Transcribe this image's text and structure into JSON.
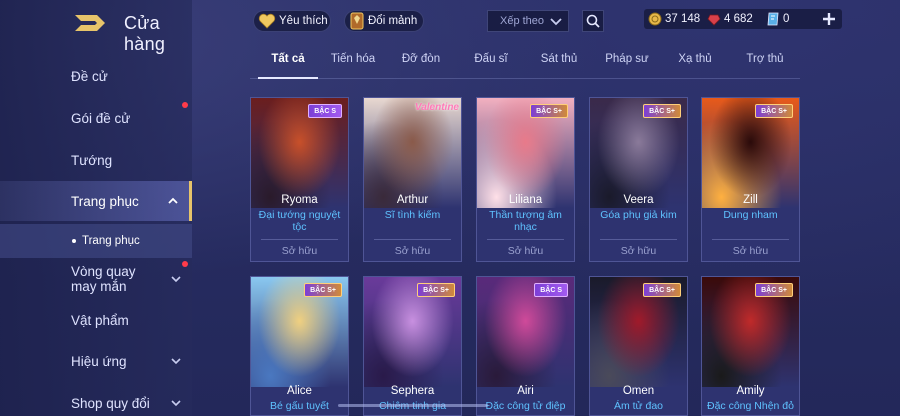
{
  "header": {
    "title": "Cửa hàng"
  },
  "sidebar": {
    "items": [
      {
        "label": "Đề cử"
      },
      {
        "label": "Gói đề cử"
      },
      {
        "label": "Tướng"
      },
      {
        "label": "Trang phục"
      },
      {
        "label": "Vòng quay may mắn"
      },
      {
        "label": "Vật phẩm"
      },
      {
        "label": "Hiệu ứng"
      },
      {
        "label": "Shop quy đổi"
      }
    ],
    "sub": {
      "label": "Trang phục"
    }
  },
  "topbar": {
    "favorite_label": "Yêu thích",
    "exchange_label": "Đổi mảnh",
    "sort_placeholder": "Xếp theo"
  },
  "currency": {
    "gold": "37 148",
    "gems": "4 682",
    "vouchers": "0"
  },
  "tabs": [
    {
      "label": "Tất cả"
    },
    {
      "label": "Tiến hóa"
    },
    {
      "label": "Đỡ đòn"
    },
    {
      "label": "Đấu sĩ"
    },
    {
      "label": "Sát thủ"
    },
    {
      "label": "Pháp sư"
    },
    {
      "label": "Xạ thủ"
    },
    {
      "label": "Trợ thủ"
    }
  ],
  "cards": [
    {
      "name": "Ryoma",
      "skin": "Đại tướng nguyệt tộc",
      "badge": "BẬC S",
      "owned": "Sở hữu",
      "art": [
        "#6b1e1e",
        "#c8502a",
        "#2a1a2a"
      ]
    },
    {
      "name": "Arthur",
      "skin": "Sĩ tình kiếm",
      "badge": "",
      "owned": "Sở hữu",
      "banner": "Valentine",
      "art": [
        "#e8d8d0",
        "#8a5a4a",
        "#3a2a3a"
      ]
    },
    {
      "name": "Liliana",
      "skin": "Thần tượng âm nhạc",
      "badge": "BẬC S+",
      "owned": "Sở hữu",
      "art": [
        "#f2b0c0",
        "#e87a8a",
        "#ffe0e8"
      ]
    },
    {
      "name": "Veera",
      "skin": "Góa phụ giả kim",
      "badge": "BẬC S+",
      "owned": "Sở hữu",
      "art": [
        "#3a2a4a",
        "#8a7a9a",
        "#1a1a2a"
      ]
    },
    {
      "name": "Zill",
      "skin": "Dung nham",
      "badge": "BẬC S+",
      "owned": "Sở hữu",
      "art": [
        "#e85a1a",
        "#2a0a0a",
        "#ffb040"
      ]
    },
    {
      "name": "Alice",
      "skin": "Bé gấu tuyết",
      "badge": "BẬC S+",
      "owned": "",
      "art": [
        "#8ac8f0",
        "#f0d080",
        "#4a78c0"
      ]
    },
    {
      "name": "Sephera",
      "skin": "Chiêm tinh gia",
      "badge": "BẬC S+",
      "owned": "",
      "art": [
        "#6a3a9a",
        "#c890e0",
        "#2a1a4a"
      ]
    },
    {
      "name": "Airi",
      "skin": "Đặc công tử điệp",
      "badge": "BẬC S",
      "owned": "",
      "art": [
        "#5a2a7a",
        "#d04a9a",
        "#2a1a3a"
      ]
    },
    {
      "name": "Omen",
      "skin": "Ám tử đao",
      "badge": "BẬC S+",
      "owned": "",
      "art": [
        "#1a1a2a",
        "#a01a2a",
        "#4a4a5a"
      ]
    },
    {
      "name": "Amily",
      "skin": "Đặc công Nhện đỏ",
      "badge": "BẬC S+",
      "owned": "",
      "art": [
        "#3a0a0a",
        "#c02a2a",
        "#1a1a1a"
      ]
    }
  ],
  "colors": {
    "accent": "#e7c46a",
    "skin_name": "#5fc2ff",
    "badge": "#8a4ae0"
  }
}
